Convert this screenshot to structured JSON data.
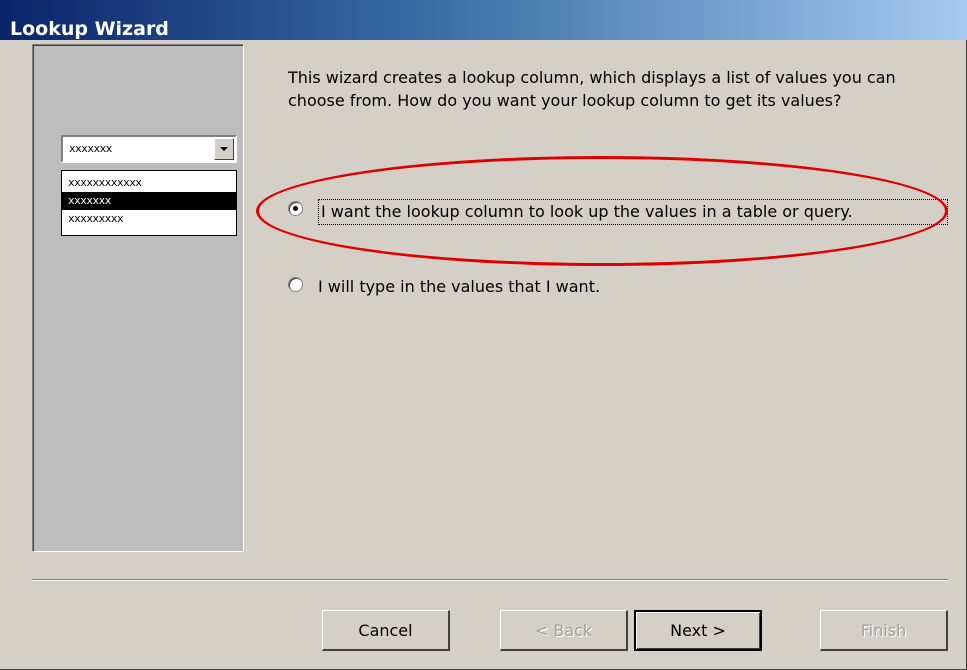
{
  "window": {
    "title": "Lookup Wizard"
  },
  "preview": {
    "combo_value": "xxxxxxx",
    "list_items": [
      "xxxxxxxxxxxx",
      "xxxxxxx",
      "xxxxxxxxx"
    ],
    "selected_index": 1
  },
  "main": {
    "description": "This wizard creates a lookup column, which displays a list of values you can choose from.  How do you want your lookup column to get its values?",
    "options": [
      {
        "label": "I want the lookup column to look up the values in a table or query.",
        "checked": true
      },
      {
        "label": "I will type in the values that I want.",
        "checked": false
      }
    ]
  },
  "annotation": {
    "color": "#e00000"
  },
  "buttons": {
    "cancel": "Cancel",
    "back": "< Back",
    "next": "Next >",
    "finish": "Finish"
  }
}
